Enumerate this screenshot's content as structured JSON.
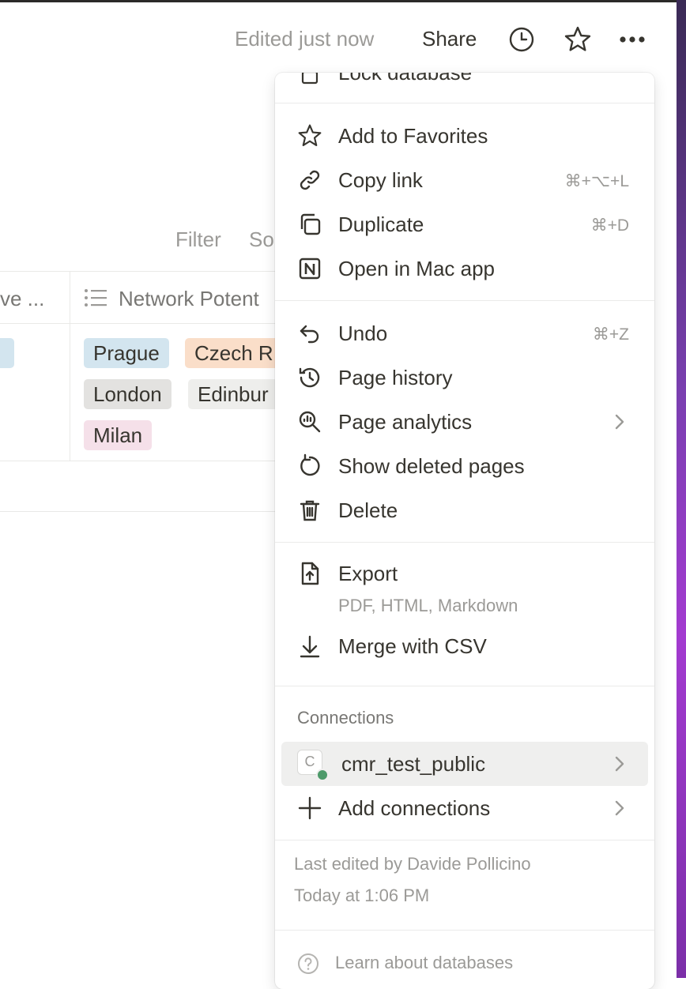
{
  "topbar": {
    "edited_label": "Edited just now",
    "share_label": "Share",
    "icons": [
      "clock-icon",
      "star-icon",
      "more-icon"
    ]
  },
  "background": {
    "toolbar": {
      "filter_label": "Filter",
      "sort_partial": "So"
    },
    "columns": [
      {
        "header": "ve ..."
      },
      {
        "header": "Network Potent",
        "icon": "list-icon"
      }
    ],
    "tags": [
      {
        "label": "Prague",
        "color": "#d3e5ef"
      },
      {
        "label": "Czech R",
        "color": "#fadec9"
      },
      {
        "label": "London",
        "color": "#e3e2e0"
      },
      {
        "label": "Edinbur",
        "color": "#eeeeec"
      },
      {
        "label": "Milan",
        "color": "#f5e0e9"
      }
    ]
  },
  "menu": {
    "top_partial": "Lock database",
    "group1": [
      {
        "label": "Add to Favorites",
        "icon": "star-icon",
        "shortcut": ""
      },
      {
        "label": "Copy link",
        "icon": "link-icon",
        "shortcut": "⌘+⌥+L"
      },
      {
        "label": "Duplicate",
        "icon": "duplicate-icon",
        "shortcut": "⌘+D"
      },
      {
        "label": "Open in Mac app",
        "icon": "notion-icon",
        "shortcut": ""
      }
    ],
    "group2": [
      {
        "label": "Undo",
        "icon": "undo-icon",
        "shortcut": "⌘+Z"
      },
      {
        "label": "Page history",
        "icon": "history-icon",
        "shortcut": ""
      },
      {
        "label": "Page analytics",
        "icon": "analytics-icon",
        "shortcut": ""
      },
      {
        "label": "Show deleted pages",
        "icon": "restore-icon",
        "shortcut": ""
      },
      {
        "label": "Delete",
        "icon": "trash-icon",
        "shortcut": ""
      }
    ],
    "export": {
      "label": "Export",
      "sublabel": "PDF, HTML, Markdown"
    },
    "merge": {
      "label": "Merge with CSV"
    },
    "connections": {
      "title": "Connections",
      "items": [
        {
          "label": "cmr_test_public",
          "avatar_letter": "C",
          "status_color": "#4d9a6a"
        },
        {
          "label": "Add connections"
        }
      ]
    },
    "footer": {
      "last_edited": "Last edited by Davide Pollicino",
      "time": "Today at 1:06 PM",
      "learn": "Learn about databases"
    }
  }
}
